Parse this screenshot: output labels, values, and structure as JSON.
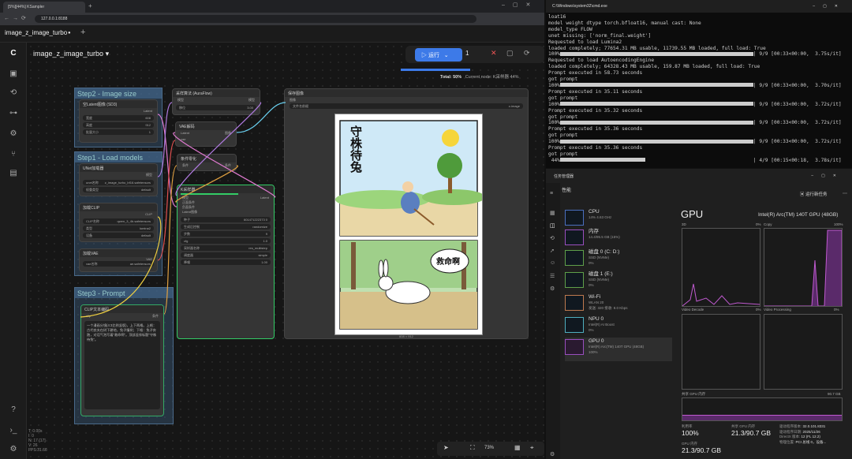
{
  "browser": {
    "tab_title": "[5%][44%] KSampler",
    "url": "127.0.0.1:8188"
  },
  "comfy": {
    "workflow_tab": "image_z_image_turbo",
    "workflow_title": "image_z_image_turbo",
    "run_label": "运行",
    "queue_count": "1",
    "status_total": "Total: 50%",
    "status_node": "Current node: K采样器 44%",
    "zoom": "73%",
    "groups": {
      "step2": "Step2 - Image size",
      "step1": "Step1 - Load models",
      "step3": "Step3 - Prompt"
    },
    "nodes": {
      "latent": {
        "title": "空Latent图像 (SD3)",
        "out": "Latent",
        "w_label": "宽度",
        "w": "608",
        "h_label": "高度",
        "h": "912",
        "b_label": "批量大小",
        "b": "1"
      },
      "unet": {
        "title": "UNet加载器",
        "out": "模型",
        "n_label": "unet名称",
        "n": "z_image_turbo_bf16.safetensors",
        "d_label": "权重类型",
        "d": "default"
      },
      "clip": {
        "title": "加载CLIP",
        "out": "CLIP",
        "n_label": "CLIP名称",
        "n": "qwen_3_4b.safetensors",
        "t_label": "类型",
        "t": "lumina2",
        "d_label": "设备",
        "d": "default"
      },
      "vae": {
        "title": "加载VAE",
        "out": "VAE",
        "n_label": "vae名称",
        "n": "ae.safetensors"
      },
      "aura": {
        "title": "采样算法 (AuraFlow)",
        "in": "模型",
        "out": "模型",
        "s_label": "移位",
        "s": "3.00"
      },
      "vaedec": {
        "title": "VAE解码",
        "in1": "Latent",
        "in2": "vae",
        "out": "图像"
      },
      "cond": {
        "title": "条件零化",
        "in": "条件",
        "out": "条件"
      },
      "ksampler": {
        "title": "K采样器",
        "in": [
          "模型",
          "正面条件",
          "负面条件",
          "Latent图像"
        ],
        "out": "Latent",
        "rows": [
          [
            "种子",
            "601471222373 0"
          ],
          [
            "生成后控制",
            "randomize"
          ],
          [
            "步数",
            "9"
          ],
          [
            "cfg",
            "1.0"
          ],
          [
            "采样器名称",
            "res_multistep"
          ],
          [
            "调度器",
            "simple"
          ],
          [
            "降噪",
            "1.00"
          ]
        ]
      },
      "cliptext": {
        "title": "CLIP文本编码",
        "in": "clip",
        "out": "条件",
        "text": "一个漫画分镜(4:3比例竖版)，上下两格。上格：古代农夫在树下耕地，兔子撞树；下格：兔子奔跑，对话气泡写着\"救命啊\"。顶部竖排标题\"守株待兔\"。"
      },
      "save": {
        "title": "保存图像",
        "in": "图像",
        "prefix_label": "文件名前缀",
        "prefix": "z-image",
        "size": "608 × 912"
      }
    },
    "panel1_title": "守株待兔",
    "panel2_bubble": "救命啊",
    "canvas_info": [
      "T: 0.00s",
      "I: 0",
      "N: 17 [17]",
      "V: 26",
      "FPS:31.66"
    ]
  },
  "terminal": {
    "title": "C:\\Windows\\system32\\cmd.exe",
    "lines": [
      "loat16",
      "model weight dtype torch.bfloat16, manual cast: None",
      "model_type FLOW",
      "unet missing: ['norm_final.weight']",
      "Requested to load Lumina2",
      "loaded completely; 77654.31 MB usable, 11739.55 MB loaded, full load: True"
    ],
    "p1": "100%",
    "p1s": "| 9/9 [00:33<00:00,  3.75s/it]",
    "l2": "Requested to load AutoencodingEngine",
    "l3": "loaded completely; 64328.43 MB usable, 159.87 MB loaded, full load: True",
    "l4": "Prompt executed in 58.73 seconds",
    "gp": "got prompt",
    "r2": "| 9/9 [00:33<00:00,  3.70s/it]",
    "e2": "Prompt executed in 35.11 seconds",
    "r3": "| 9/9 [00:33<00:00,  3.72s/it]",
    "e3": "Prompt executed in 35.32 seconds",
    "r4": "| 9/9 [00:33<00:00,  3.72s/it]",
    "e4": "Prompt executed in 35.36 seconds",
    "r5": "| 9/9 [00:33<00:00,  3.72s/it]",
    "e5": "Prompt executed in 35.36 seconds",
    "p6": " 44%",
    "r6": "| 4/9 [00:15<00:18,  3.78s/it]"
  },
  "taskmgr": {
    "title": "任务管理器",
    "section": "性能",
    "run_new": "运行新任务",
    "items": [
      {
        "name": "CPU",
        "sub": "14% 4.63 GHz"
      },
      {
        "name": "内存",
        "sub": "14.4/95.5 GB (15%)"
      },
      {
        "name": "磁盘 0 (C: D:)",
        "sub": "SSD (NVMe)",
        "sub2": "0%"
      },
      {
        "name": "磁盘 1 (E:)",
        "sub": "SSD (NVMe)",
        "sub2": "0%"
      },
      {
        "name": "Wi-Fi",
        "sub": "WLAN 20",
        "sub2": "发送: 320 接收: 8.0 Kbps"
      },
      {
        "name": "NPU 0",
        "sub": "Intel(R) AI Boost",
        "sub2": "0%"
      },
      {
        "name": "GPU 0",
        "sub": "Intel(R) Arc(TM) 140T GPU (48GB)",
        "sub2": "100%"
      }
    ],
    "gpu_title": "GPU",
    "gpu_name": "Intel(R) Arc(TM) 140T GPU (48GB)",
    "g1": "3D",
    "g1p": "0%",
    "g2": "Copy",
    "g2p": "100%",
    "g3": "Video Decode",
    "g3p": "0%",
    "g4": "Video Processing",
    "g4p": "0%",
    "shared_label": "共享 GPU 内存",
    "shared_max": "90.7 GB",
    "util_label": "利用率",
    "util": "100%",
    "shared_mem_label": "共享 GPU 内存",
    "shared_mem": "21.3/90.7 GB",
    "gpu_mem_label": "GPU 内存",
    "gpu_mem": "21.3/90.7 GB",
    "drv": [
      [
        "驱动程序版本:",
        "32.0.101.8331"
      ],
      [
        "驱动程序日期:",
        "2025/11/26"
      ],
      [
        "DirectX 版本:",
        "12 (FL 12.2)"
      ],
      [
        "物理位置:",
        "PCI 总线 0，设备..."
      ]
    ]
  }
}
